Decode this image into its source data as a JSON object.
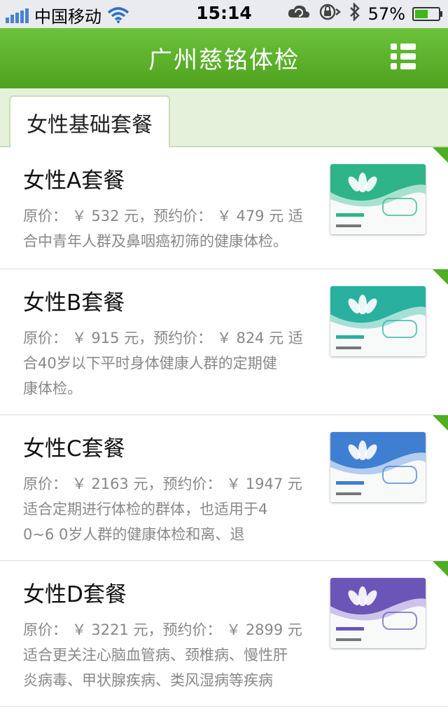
{
  "status_bar": {
    "carrier": "中国移动",
    "time": "15:14",
    "battery": "57%"
  },
  "header": {
    "title": "广州慈铭体检"
  },
  "tab": {
    "label": "女性基础套餐"
  },
  "packages": [
    {
      "name": "女性A套餐",
      "desc_lines": [
        "原价： ￥ 532 元，预约价： ￥ 479 元 适",
        "合中青年人群及鼻咽癌初筛的健康体检。"
      ],
      "card_color": "#2fb48a",
      "card_color2": "#a8e2cf"
    },
    {
      "name": "女性B套餐",
      "desc_lines": [
        "原价： ￥ 915 元，预约价： ￥ 824 元 适",
        "合40岁以下平时身体健康人群的定期健",
        "康体检。"
      ],
      "card_color": "#2ab09e",
      "card_color2": "#a5e0d7"
    },
    {
      "name": "女性C套餐",
      "desc_lines": [
        "原价： ￥ 2163 元，预约价： ￥ 1947 元",
        "适合定期进行体检的群体，也适用于4",
        "0~6 0岁人群的健康体检和离、退"
      ],
      "card_color": "#3f7fd1",
      "card_color2": "#b3cdf0"
    },
    {
      "name": "女性D套餐",
      "desc_lines": [
        "原价： ￥ 3221 元，预约价： ￥ 2899 元",
        "适合更关注心脑血管病、颈椎病、慢性肝",
        "炎病毒、甲状腺疾病、类风湿病等疾病"
      ],
      "card_color": "#6a56b6",
      "card_color2": "#cdc4ec"
    }
  ]
}
